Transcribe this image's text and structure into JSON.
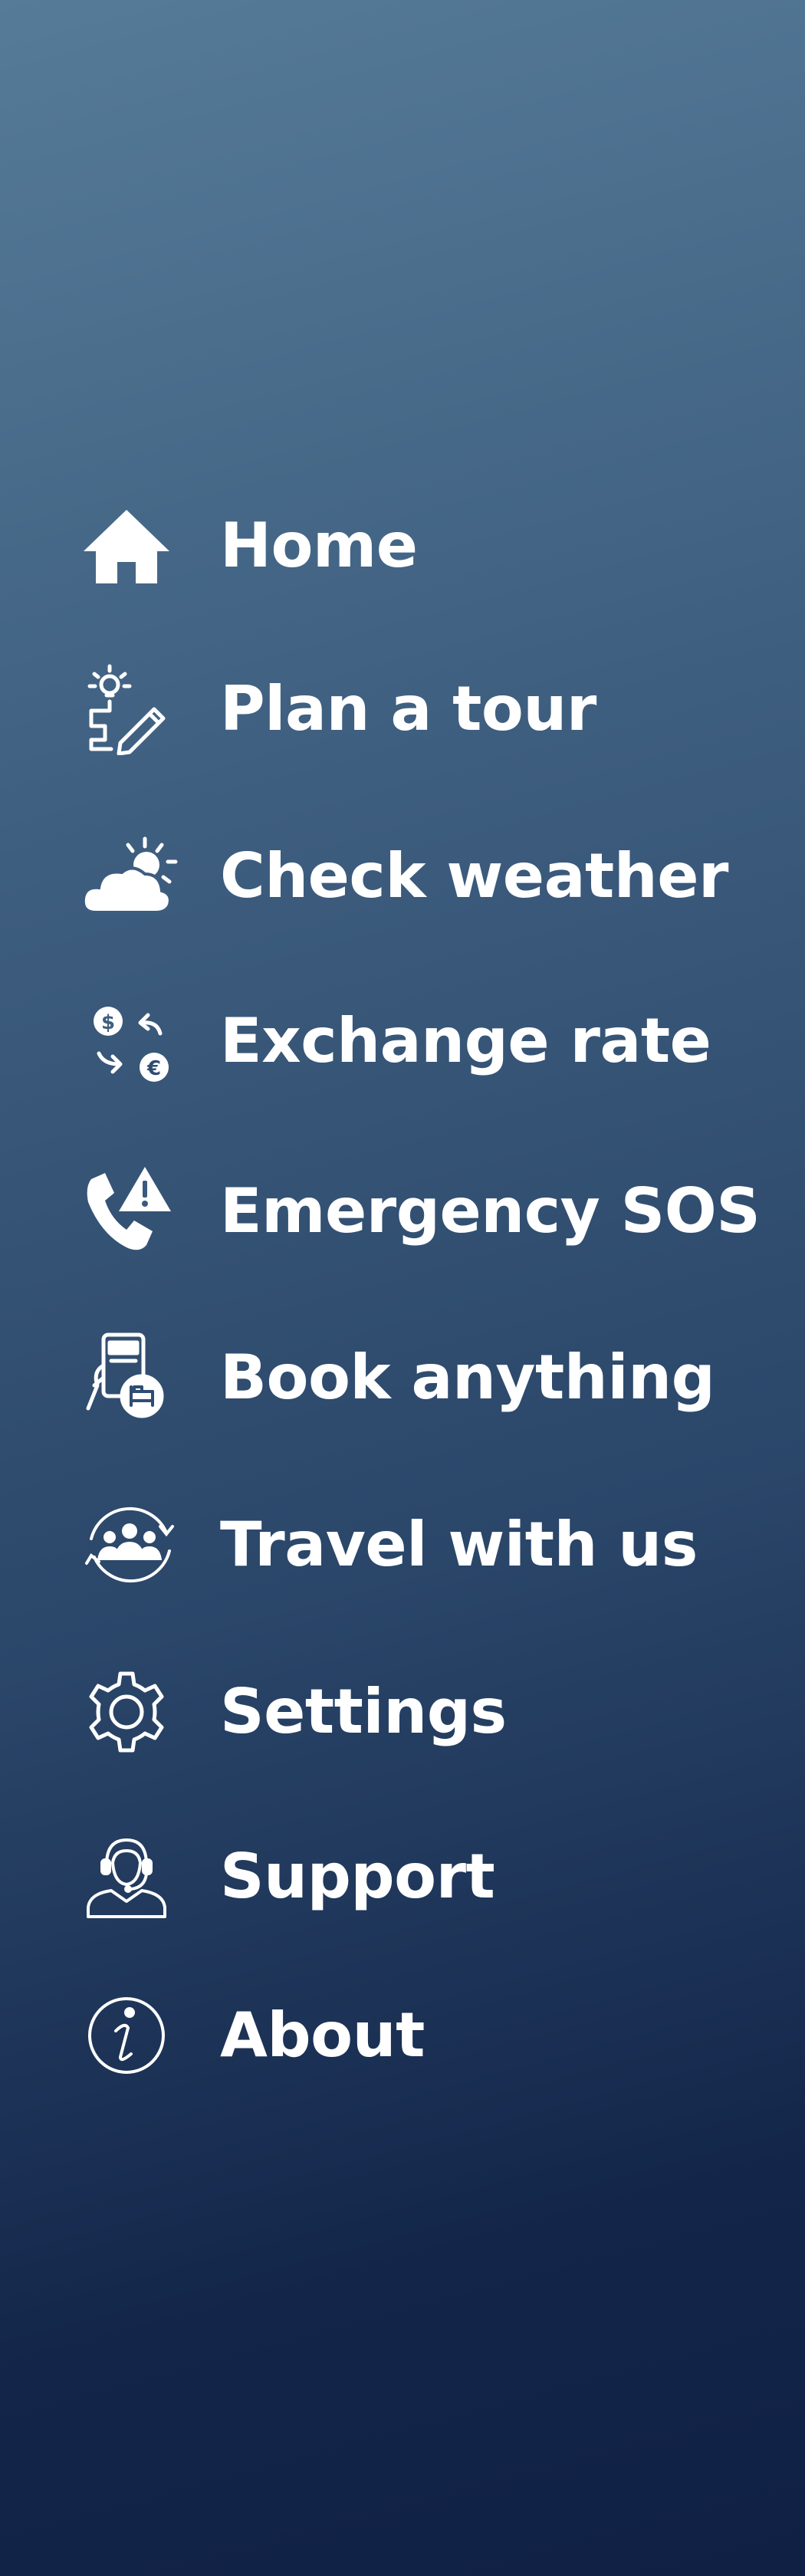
{
  "background": {
    "top_color": "#557b98",
    "bottom_color": "#0f2044"
  },
  "menu": {
    "items": [
      {
        "label": "Home",
        "icon": "home-icon"
      },
      {
        "label": "Plan a tour",
        "icon": "plan-tour-icon"
      },
      {
        "label": "Check weather",
        "icon": "weather-icon"
      },
      {
        "label": "Exchange rate",
        "icon": "currency-exchange-icon"
      },
      {
        "label": "Emergency SOS",
        "icon": "emergency-phone-icon"
      },
      {
        "label": "Book anything",
        "icon": "booking-icon"
      },
      {
        "label": "Travel with us",
        "icon": "group-travel-icon"
      },
      {
        "label": "Settings",
        "icon": "gear-icon"
      },
      {
        "label": "Support",
        "icon": "headset-icon"
      },
      {
        "label": "About",
        "icon": "info-icon"
      }
    ]
  }
}
